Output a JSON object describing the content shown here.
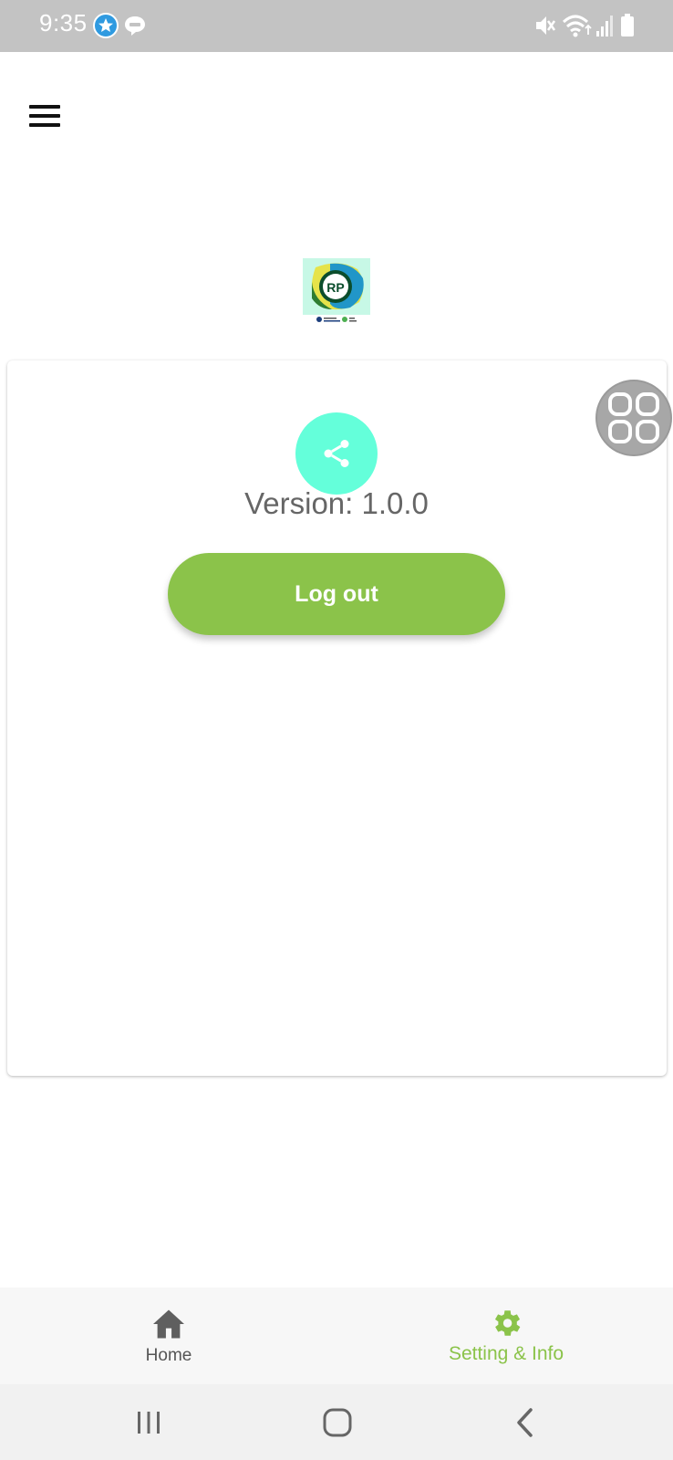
{
  "status_bar": {
    "time": "9:35",
    "notification_icons": [
      "star-app-icon",
      "line-app-icon"
    ],
    "right_icons": [
      "mute-icon",
      "wifi-icon",
      "signal-icon",
      "battery-icon"
    ]
  },
  "logo": {
    "text": "RP"
  },
  "card": {
    "version_text": "Version: 1.0.0",
    "logout_label": "Log out"
  },
  "bottom_nav": {
    "items": [
      {
        "label": "Home",
        "icon": "home-icon",
        "active": false
      },
      {
        "label": "Setting & Info",
        "icon": "gear-icon",
        "active": true
      }
    ]
  },
  "colors": {
    "accent_green": "#8bc34a",
    "share_teal": "#64ffda",
    "status_bar": "#c3c3c3"
  }
}
